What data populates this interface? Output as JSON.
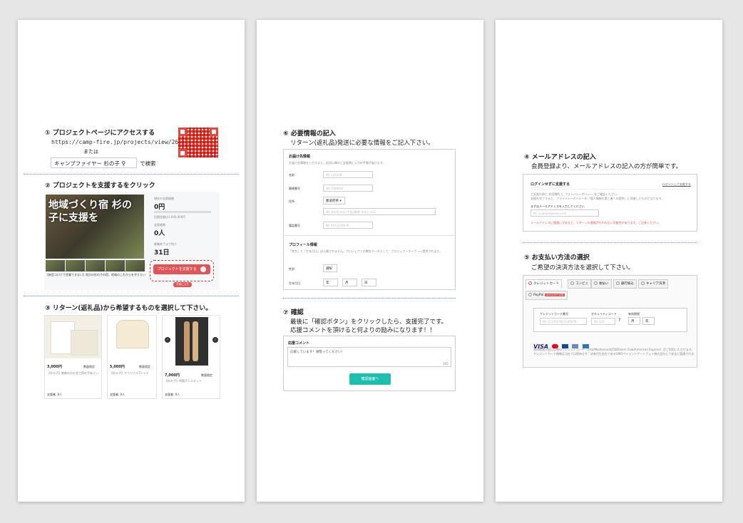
{
  "page1": {
    "step1": {
      "title": "① プロジェクトページにアクセスする",
      "url": "https://camp-fire.jp/projects/view/268381",
      "or": "または",
      "search_term": "キャンプファイヤー 杉の子",
      "search_suffix": "で検索"
    },
    "step2": {
      "title": "② プロジェクトを支援するをクリック",
      "banner_text": "地域づくり宿 杉の子に支援を",
      "raised_label": "現在の支援総額",
      "raised": "0円",
      "goal_note": "目標金額は1,000,000円",
      "backers_label": "支援者数",
      "backers": "0人",
      "days_label": "募集終了まで残り",
      "days": "31日",
      "support_btn": "プロジェクトを支援する",
      "favorite": "お気に入り",
      "desc": "【新型コロナで営業できない】地方の杉の子の宿、地域のこれからを守りたい"
    },
    "step3": {
      "title": "③ リターン(返礼品)から希望するものを選択して下さい。",
      "items": [
        {
          "price": "3,000円",
          "tag": "数量限定",
          "desc": "【杉の子】感謝のお礼状と宿の手ぬぐい",
          "footer": "支援者: 0人"
        },
        {
          "price": "5,000円",
          "tag": "数量限定",
          "desc": "【杉の子】オリジナルTシャツ",
          "footer": "支援者: 0人"
        },
        {
          "price": "7,000円",
          "tag": "数量限定",
          "desc": "【杉の子】特製ボトルセット",
          "footer": "支援者: 0人"
        }
      ]
    }
  },
  "page2": {
    "step6": {
      "title": "⑥ 必要情報の記入",
      "subtitle": "リターン(返礼品)発送に必要な情報をご記入下さい。",
      "form_title": "お届け先情報",
      "form_note": "お届け先情報を入力すると、次回以降のご支援時に入力の手間が省けます。",
      "name_label": "名前",
      "name_ph": "例) 山田太郎",
      "zip_label": "郵便番号",
      "zip_ph": "例) 1500002",
      "addr_label": "住所",
      "pref": "都道府県",
      "addr_ph": "例) 渋谷区渋谷1丁目2番地 渋谷ビル2F",
      "tel_label": "電話番号",
      "tel_ph": "例) 0312345678",
      "profile_title": "プロフィール情報",
      "profile_note": "「性別」と「生年月日」は公開されません。プロジェクトの集計データとして、プロジェクトオーナーへ提供されます。",
      "gender_label": "性別",
      "gender_sel": "選択",
      "birth_label": "生年月日",
      "year": "年",
      "month": "月",
      "day": "日"
    },
    "step7": {
      "title": "⑦ 確認",
      "line1": "最後に「確認ボタン」をクリックしたら、支援完了です。",
      "line2": "応援コメントを頂けると何よりの励みになります！！",
      "comment_title": "応援コメント",
      "comment_ph": "応援しています！頑張ってください！",
      "count": "300",
      "confirm_btn": "確認画面へ"
    }
  },
  "page3": {
    "step4": {
      "title": "④ メールアドレスの記入",
      "subtitle": "会員登録より、メールアドレスの記入の方が簡単です。",
      "box_title": "ログインせずに支援する",
      "login_link": "ログインして支援する",
      "note1": "ご支援の前に 利用規約 と プライバシーポリシー をご確認ください。",
      "note2": "支援を完了すると、プライバシーポリシーの「個人情報の第三者への提供」に同意したものとなります。",
      "email_label": "まずはメールアドレスを入力してください",
      "email_ph": "例) example@mail.com",
      "warning": "メールアドレスに間違いがあると、リターンの連絡が行われない可能性があります。ご注意ください。"
    },
    "step5": {
      "title": "⑤ お支払い方法の選択",
      "subtitle": "ご希望の決済方法を選択して下さい。",
      "tabs": [
        "クレジットカード",
        "コンビニ",
        "後払い",
        "銀行振込",
        "キャリア決済"
      ],
      "paypal": "PayPal",
      "paypal_badge": "キャンペーン中",
      "card_label": "クレジットカード番号",
      "card_ph": "例) 1234567812345678",
      "cvc_label": "セキュリティコード",
      "cvc_ph": "例) 123",
      "exp_label": "有効期限",
      "exp_month": "月",
      "exp_year": "年",
      "brands": "VISA",
      "note1": "有効期限が翌日以降のクレジットカード（Visa/Mastercard/JCB/Diners Club/American Express）がご利用いただけます。",
      "note2": "クレジットカード情報は当社では保持せず、決済代行会社であるGMOペイメントゲートウェイ株式会社にて安全に管理されます。"
    }
  },
  "colors": {
    "accent_red": "#e05656",
    "teal": "#1fbfb0",
    "dotted": "#6a8fc7"
  }
}
